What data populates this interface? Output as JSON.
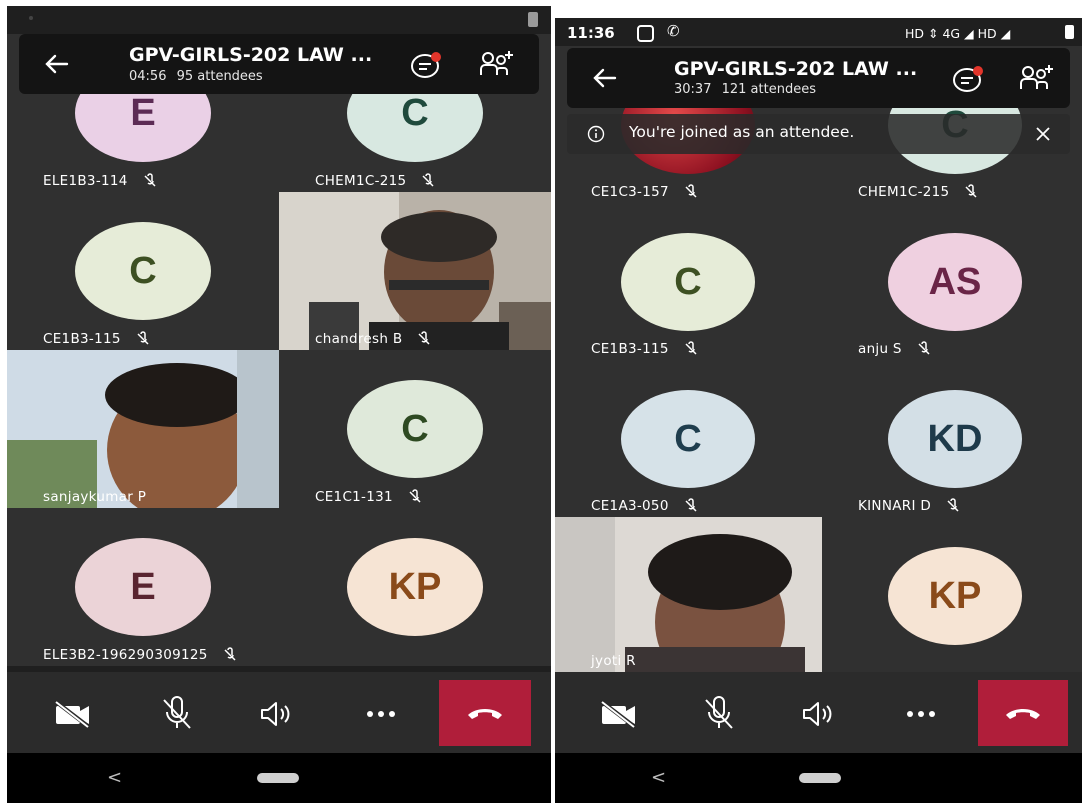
{
  "left": {
    "status_bar": {
      "battery_icon": "battery-icon"
    },
    "header": {
      "title": "GPV-GIRLS-202 LAW ...",
      "duration": "04:56",
      "attendees": "95 attendees"
    },
    "tiles": [
      {
        "name": "ELE1B3-114",
        "initials": "E",
        "avatar_bg": "#ead0e6",
        "avatar_fg": "#5c2b55"
      },
      {
        "name": "CHEM1C-215",
        "initials": "C",
        "avatar_bg": "#d8e8e1",
        "avatar_fg": "#1f4a3c"
      },
      {
        "name": "CE1B3-115",
        "initials": "C",
        "avatar_bg": "#e6ecd8",
        "avatar_fg": "#3d5022"
      },
      {
        "name": "chandresh B",
        "video": true
      },
      {
        "name": "sanjaykumar P",
        "video": true
      },
      {
        "name": "CE1C1-131",
        "initials": "C",
        "avatar_bg": "#dfe9da",
        "avatar_fg": "#2e4a22"
      },
      {
        "name": "ELE3B2-196290309125",
        "initials": "E",
        "avatar_bg": "#ebd3d7",
        "avatar_fg": "#5a2430"
      },
      {
        "name": "",
        "initials": "KP",
        "avatar_bg": "#f6e4d4",
        "avatar_fg": "#8a4a1a"
      }
    ],
    "nav": {
      "back": "<"
    }
  },
  "right": {
    "status_bar": {
      "time": "11:36",
      "indicators": "HD ⇕ 4G ◢ HD ◢"
    },
    "header": {
      "title": "GPV-GIRLS-202 LAW ...",
      "duration": "30:37",
      "attendees": "121 attendees"
    },
    "banner": {
      "text": "You're joined as an attendee."
    },
    "tiles": [
      {
        "name": "CE1C3-157",
        "video": true
      },
      {
        "name": "CHEM1C-215",
        "initials": "C",
        "avatar_bg": "#d8e8e1",
        "avatar_fg": "#1f4a3c"
      },
      {
        "name": "CE1B3-115",
        "initials": "C",
        "avatar_bg": "#e6ecd8",
        "avatar_fg": "#3d5022"
      },
      {
        "name": "anju S",
        "initials": "AS",
        "avatar_bg": "#efd0e0",
        "avatar_fg": "#6a2547"
      },
      {
        "name": "CE1A3-050",
        "initials": "C",
        "avatar_bg": "#d6e2e8",
        "avatar_fg": "#1f3d4d"
      },
      {
        "name": "KINNARI D",
        "initials": "KD",
        "avatar_bg": "#d3dfe6",
        "avatar_fg": "#1e3a4a"
      },
      {
        "name": "jyoti R",
        "video": true
      },
      {
        "name": "",
        "initials": "KP",
        "avatar_bg": "#f6e4d4",
        "avatar_fg": "#8a4a1a"
      }
    ],
    "nav": {
      "back": "<"
    }
  },
  "colors": {
    "background": "#1f1f1f",
    "tile": "#303030",
    "hangup": "#b01e3a",
    "notification_dot": "#e3352b"
  }
}
